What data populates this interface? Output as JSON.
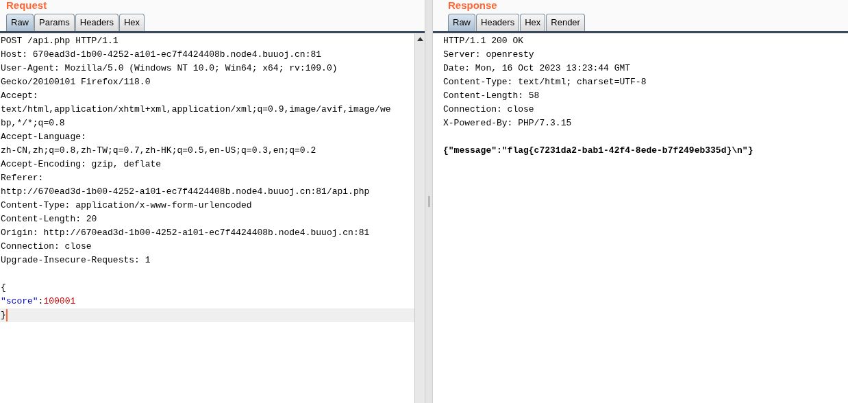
{
  "request": {
    "title": "Request",
    "tabs": [
      {
        "label": "Raw",
        "selected": true
      },
      {
        "label": "Params",
        "selected": false
      },
      {
        "label": "Headers",
        "selected": false
      },
      {
        "label": "Hex",
        "selected": false
      }
    ],
    "lines": [
      {
        "kind": "plain",
        "text": "POST /api.php HTTP/1.1",
        "current": false
      },
      {
        "kind": "plain",
        "text": "Host: 670ead3d-1b00-4252-a101-ec7f4424408b.node4.buuoj.cn:81",
        "current": false
      },
      {
        "kind": "plain",
        "text": "User-Agent: Mozilla/5.0 (Windows NT 10.0; Win64; x64; rv:109.0)",
        "current": false
      },
      {
        "kind": "plain",
        "text": "Gecko/20100101 Firefox/118.0",
        "current": false
      },
      {
        "kind": "plain",
        "text": "Accept:",
        "current": false
      },
      {
        "kind": "plain",
        "text": "text/html,application/xhtml+xml,application/xml;q=0.9,image/avif,image/we",
        "current": false
      },
      {
        "kind": "plain",
        "text": "bp,*/*;q=0.8",
        "current": false
      },
      {
        "kind": "plain",
        "text": "Accept-Language:",
        "current": false
      },
      {
        "kind": "plain",
        "text": "zh-CN,zh;q=0.8,zh-TW;q=0.7,zh-HK;q=0.5,en-US;q=0.3,en;q=0.2",
        "current": false
      },
      {
        "kind": "plain",
        "text": "Accept-Encoding: gzip, deflate",
        "current": false
      },
      {
        "kind": "plain",
        "text": "Referer:",
        "current": false
      },
      {
        "kind": "plain",
        "text": "http://670ead3d-1b00-4252-a101-ec7f4424408b.node4.buuoj.cn:81/api.php",
        "current": false
      },
      {
        "kind": "plain",
        "text": "Content-Type: application/x-www-form-urlencoded",
        "current": false
      },
      {
        "kind": "plain",
        "text": "Content-Length: 20",
        "current": false
      },
      {
        "kind": "plain",
        "text": "Origin: http://670ead3d-1b00-4252-a101-ec7f4424408b.node4.buuoj.cn:81",
        "current": false
      },
      {
        "kind": "plain",
        "text": "Connection: close",
        "current": false
      },
      {
        "kind": "plain",
        "text": "Upgrade-Insecure-Requests: 1",
        "current": false
      },
      {
        "kind": "blank"
      },
      {
        "kind": "plain",
        "text": "{",
        "current": false
      },
      {
        "kind": "pair",
        "key": "\"score\"",
        "sep": ":",
        "value": "100001",
        "current": false
      },
      {
        "kind": "plain",
        "text": "}",
        "current": true
      }
    ]
  },
  "response": {
    "title": "Response",
    "tabs": [
      {
        "label": "Raw",
        "selected": true
      },
      {
        "label": "Headers",
        "selected": false
      },
      {
        "label": "Hex",
        "selected": false
      },
      {
        "label": "Render",
        "selected": false
      }
    ],
    "lines": [
      {
        "kind": "plain",
        "text": "HTTP/1.1 200 OK"
      },
      {
        "kind": "plain",
        "text": "Server: openresty"
      },
      {
        "kind": "plain",
        "text": "Date: Mon, 16 Oct 2023 13:23:44 GMT"
      },
      {
        "kind": "plain",
        "text": "Content-Type: text/html; charset=UTF-8"
      },
      {
        "kind": "plain",
        "text": "Content-Length: 58"
      },
      {
        "kind": "plain",
        "text": "Connection: close"
      },
      {
        "kind": "plain",
        "text": "X-Powered-By: PHP/7.3.15"
      },
      {
        "kind": "blank"
      },
      {
        "kind": "bold",
        "text": "{\"message\":\"flag{c7231da2-bab1-42f4-8ede-b7f249eb335d}\\n\"}"
      }
    ]
  }
}
